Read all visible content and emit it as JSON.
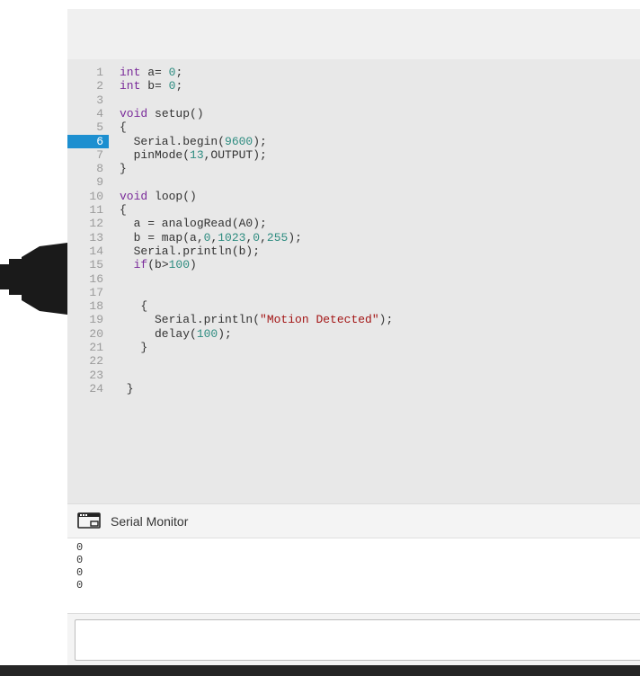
{
  "editor": {
    "active_line": 6,
    "lines": [
      {
        "n": "1",
        "tokens": [
          [
            "kw",
            "int"
          ],
          [
            "t",
            " a= "
          ],
          [
            "num",
            "0"
          ],
          [
            "t",
            ";"
          ]
        ]
      },
      {
        "n": "2",
        "tokens": [
          [
            "kw",
            "int"
          ],
          [
            "t",
            " b= "
          ],
          [
            "num",
            "0"
          ],
          [
            "t",
            ";"
          ]
        ]
      },
      {
        "n": "3",
        "tokens": []
      },
      {
        "n": "4",
        "tokens": [
          [
            "kw",
            "void"
          ],
          [
            "t",
            " setup()"
          ]
        ]
      },
      {
        "n": "5",
        "tokens": [
          [
            "t",
            "{"
          ]
        ]
      },
      {
        "n": "6",
        "tokens": [
          [
            "t",
            "  Serial.begin("
          ],
          [
            "num",
            "9600"
          ],
          [
            "t",
            ");"
          ]
        ]
      },
      {
        "n": "7",
        "tokens": [
          [
            "t",
            "  pinMode("
          ],
          [
            "num",
            "13"
          ],
          [
            "t",
            ",OUTPUT);"
          ]
        ]
      },
      {
        "n": "8",
        "tokens": [
          [
            "t",
            "}"
          ]
        ]
      },
      {
        "n": "9",
        "tokens": []
      },
      {
        "n": "10",
        "tokens": [
          [
            "kw",
            "void"
          ],
          [
            "t",
            " loop()"
          ]
        ]
      },
      {
        "n": "11",
        "tokens": [
          [
            "t",
            "{"
          ]
        ]
      },
      {
        "n": "12",
        "tokens": [
          [
            "t",
            "  a = analogRead(A0);"
          ]
        ]
      },
      {
        "n": "13",
        "tokens": [
          [
            "t",
            "  b = map(a,"
          ],
          [
            "num",
            "0"
          ],
          [
            "t",
            ","
          ],
          [
            "num",
            "1023"
          ],
          [
            "t",
            ","
          ],
          [
            "num",
            "0"
          ],
          [
            "t",
            ","
          ],
          [
            "num",
            "255"
          ],
          [
            "t",
            ");"
          ]
        ]
      },
      {
        "n": "14",
        "tokens": [
          [
            "t",
            "  Serial.println(b);"
          ]
        ]
      },
      {
        "n": "15",
        "tokens": [
          [
            "t",
            "  "
          ],
          [
            "kw",
            "if"
          ],
          [
            "t",
            "(b>"
          ],
          [
            "num",
            "100"
          ],
          [
            "t",
            ")"
          ]
        ]
      },
      {
        "n": "16",
        "tokens": []
      },
      {
        "n": "17",
        "tokens": []
      },
      {
        "n": "18",
        "tokens": [
          [
            "t",
            "   {"
          ]
        ]
      },
      {
        "n": "19",
        "tokens": [
          [
            "t",
            "     Serial.println("
          ],
          [
            "str",
            "\"Motion Detected\""
          ],
          [
            "t",
            ");"
          ]
        ]
      },
      {
        "n": "20",
        "tokens": [
          [
            "t",
            "     delay("
          ],
          [
            "num",
            "100"
          ],
          [
            "t",
            ");"
          ]
        ]
      },
      {
        "n": "21",
        "tokens": [
          [
            "t",
            "   }"
          ]
        ]
      },
      {
        "n": "22",
        "tokens": []
      },
      {
        "n": "23",
        "tokens": []
      },
      {
        "n": "24",
        "tokens": [
          [
            "t",
            " }"
          ]
        ]
      }
    ]
  },
  "serial_monitor": {
    "title": "Serial Monitor",
    "output_lines": [
      "0",
      "0",
      "0",
      "0"
    ],
    "input_value": "",
    "icon": "serial-monitor-icon"
  },
  "colors": {
    "active_line_marker": "#1d8fd0",
    "keyword": "#7a2b9a",
    "number": "#2e8c80",
    "string": "#a31515"
  }
}
